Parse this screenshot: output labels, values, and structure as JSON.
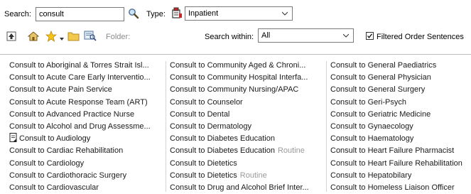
{
  "search": {
    "label": "Search:",
    "value": "consult",
    "type_label": "Type:",
    "type_value": "Inpatient"
  },
  "toolbar": {
    "folder_label": "Folder:",
    "search_within_label": "Search within:",
    "search_within_value": "All",
    "filtered_checkbox_label": "Filtered Order Sentences",
    "filtered_checked": true
  },
  "results": {
    "columns": [
      [
        {
          "text": "Consult to Aboriginal & Torres Strait Isl...",
          "note": ""
        },
        {
          "text": "Consult to Acute Care Early Interventio...",
          "note": ""
        },
        {
          "text": "Consult to Acute Pain Service",
          "note": ""
        },
        {
          "text": "Consult to Acute Response Team (ART)",
          "note": ""
        },
        {
          "text": "Consult to Advanced Practice Nurse",
          "note": ""
        },
        {
          "text": "Consult to Alcohol and Drug Assessme...",
          "note": ""
        },
        {
          "text": "Consult to Audiology",
          "note": "",
          "icon": "document-icon"
        },
        {
          "text": "Consult to Cardiac Rehabilitation",
          "note": ""
        },
        {
          "text": "Consult to Cardiology",
          "note": ""
        },
        {
          "text": "Consult to Cardiothoracic Surgery",
          "note": ""
        },
        {
          "text": "Consult to Cardiovascular",
          "note": ""
        }
      ],
      [
        {
          "text": "Consult to Community Aged & Chroni...",
          "note": ""
        },
        {
          "text": "Consult to Community Hospital Interfa...",
          "note": ""
        },
        {
          "text": "Consult to Community Nursing/APAC",
          "note": ""
        },
        {
          "text": "Consult to Counselor",
          "note": ""
        },
        {
          "text": "Consult to Dental",
          "note": ""
        },
        {
          "text": "Consult to Dermatology",
          "note": ""
        },
        {
          "text": "Consult to Diabetes Education",
          "note": ""
        },
        {
          "text": "Consult to Diabetes Education",
          "note": "Routine"
        },
        {
          "text": "Consult to Dietetics",
          "note": ""
        },
        {
          "text": "Consult to Dietetics",
          "note": "Routine"
        },
        {
          "text": "Consult to Drug and Alcohol Brief Inter...",
          "note": ""
        }
      ],
      [
        {
          "text": "Consult to General Paediatrics",
          "note": ""
        },
        {
          "text": "Consult to General Physician",
          "note": ""
        },
        {
          "text": "Consult to General Surgery",
          "note": ""
        },
        {
          "text": "Consult to Geri-Psych",
          "note": ""
        },
        {
          "text": "Consult to Geriatric Medicine",
          "note": ""
        },
        {
          "text": "Consult to Gynaecology",
          "note": ""
        },
        {
          "text": "Consult to Haematology",
          "note": ""
        },
        {
          "text": "Consult to Heart Failure Pharmacist",
          "note": ""
        },
        {
          "text": "Consult to Heart Failure Rehabilitation",
          "note": ""
        },
        {
          "text": "Consult to Hepatobilary",
          "note": ""
        },
        {
          "text": "Consult to Homeless Liaison Officer",
          "note": ""
        }
      ]
    ]
  },
  "colors": {
    "folder_label": "#8a8a8a",
    "routine": "#9a9a9a",
    "separator": "#bdbdbd"
  }
}
